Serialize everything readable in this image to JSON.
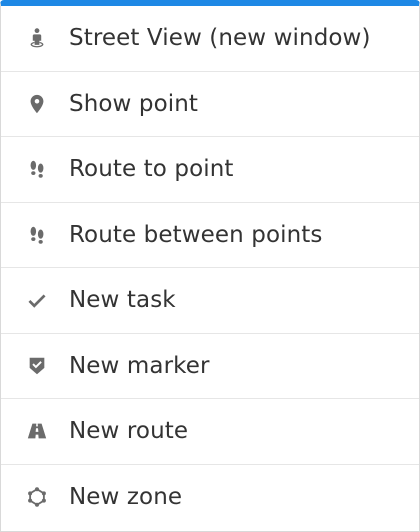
{
  "menu": {
    "accent_color": "#1e88e5",
    "icon_color": "#6b6b6b",
    "items": [
      {
        "label": "Street View (new window)",
        "icon": "street-view-icon"
      },
      {
        "label": "Show point",
        "icon": "map-marker-icon"
      },
      {
        "label": "Route to point",
        "icon": "footprints-icon"
      },
      {
        "label": "Route between points",
        "icon": "footprints-icon"
      },
      {
        "label": "New task",
        "icon": "check-icon"
      },
      {
        "label": "New marker",
        "icon": "shield-check-icon"
      },
      {
        "label": "New route",
        "icon": "road-icon"
      },
      {
        "label": "New zone",
        "icon": "polygon-icon"
      }
    ]
  }
}
